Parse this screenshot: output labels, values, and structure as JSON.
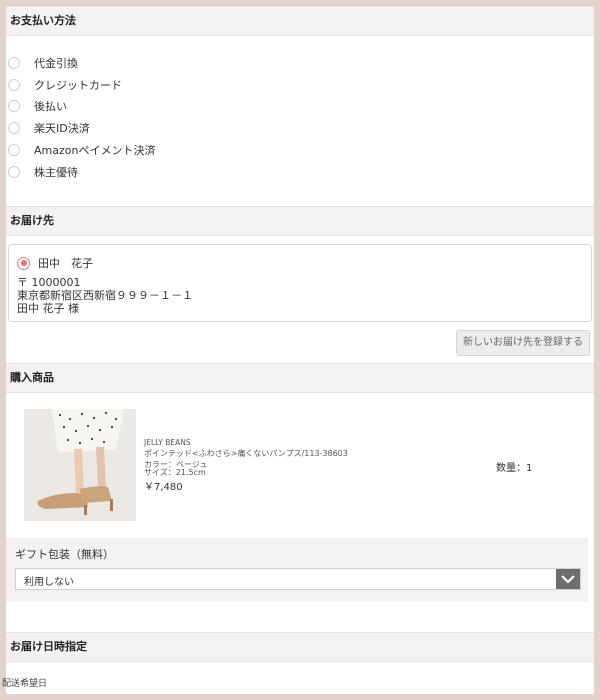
{
  "payment": {
    "header": "お支払い方法",
    "options": [
      {
        "label": "代金引換"
      },
      {
        "label": "クレジットカード"
      },
      {
        "label": "後払い"
      },
      {
        "label": "楽天ID決済"
      },
      {
        "label": "Amazonペイメント決済"
      },
      {
        "label": "株主優待"
      }
    ]
  },
  "delivery": {
    "header": "お届け先",
    "selected": true,
    "name": "田中　花子",
    "postal": "〒 1000001",
    "address": "東京都新宿区西新宿９９９－１－１",
    "recipient": "田中 花子 様",
    "new_address_button": "新しいお届け先を登録する"
  },
  "products": {
    "header": "購入商品",
    "items": [
      {
        "brand": "JELLY BEANS",
        "name": "ポインテッド<ふわさら>痛くないパンプス/113-38603",
        "color": "カラー：ベージュ",
        "size": "サイズ：21.5cm",
        "price": "￥7,480",
        "quantity": "数量：1"
      }
    ]
  },
  "gift": {
    "label": "ギフト包装（無料）",
    "selected": "利用しない"
  },
  "datetime": {
    "header": "お届け日時指定",
    "desired_date_label": "配送希望日"
  }
}
